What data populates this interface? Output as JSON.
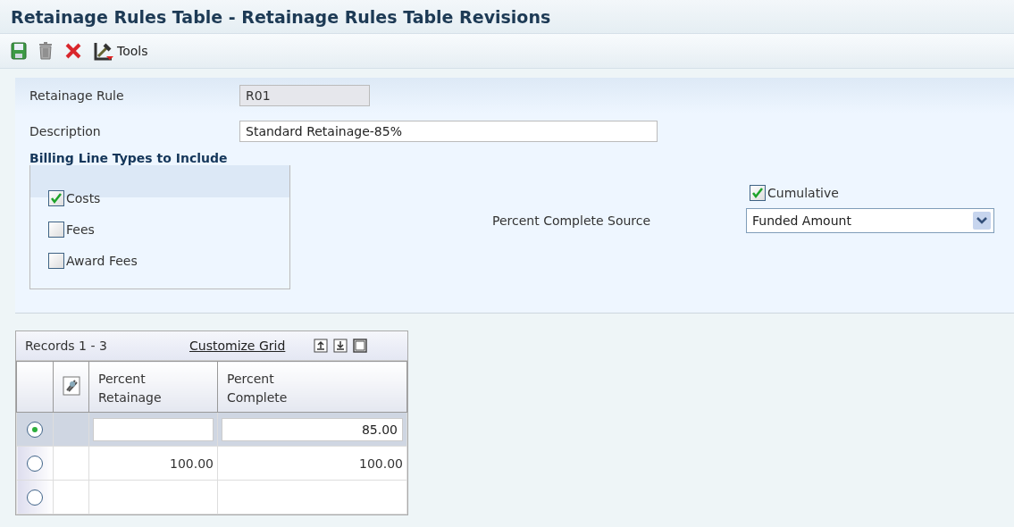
{
  "window": {
    "title": "Retainage Rules Table - Retainage Rules Table Revisions"
  },
  "toolbar": {
    "tools_label": "Tools"
  },
  "form": {
    "retainage_rule": {
      "label": "Retainage Rule",
      "value": "R01",
      "disabled": true
    },
    "description": {
      "label": "Description",
      "value": "Standard Retainage-85%"
    },
    "billing_group": {
      "title": "Billing Line Types to Include",
      "options": [
        {
          "label": "Costs",
          "checked": true
        },
        {
          "label": "Fees",
          "checked": false
        },
        {
          "label": "Award Fees",
          "checked": false
        }
      ]
    },
    "cumulative": {
      "label": "Cumulative",
      "checked": true
    },
    "percent_complete_source": {
      "label": "Percent Complete Source",
      "value": "Funded Amount"
    }
  },
  "grid": {
    "records": "Records 1 - 3",
    "customize_link": "Customize Grid",
    "columns": [
      "Percent Retainage",
      "Percent Complete"
    ],
    "rows": [
      {
        "selected": true,
        "editing": true,
        "percent_complete": "85.00"
      },
      {
        "selected": false,
        "editing": false,
        "percent_retainage": "100.00",
        "percent_complete": "100.00"
      },
      {
        "selected": false,
        "editing": false
      }
    ]
  }
}
